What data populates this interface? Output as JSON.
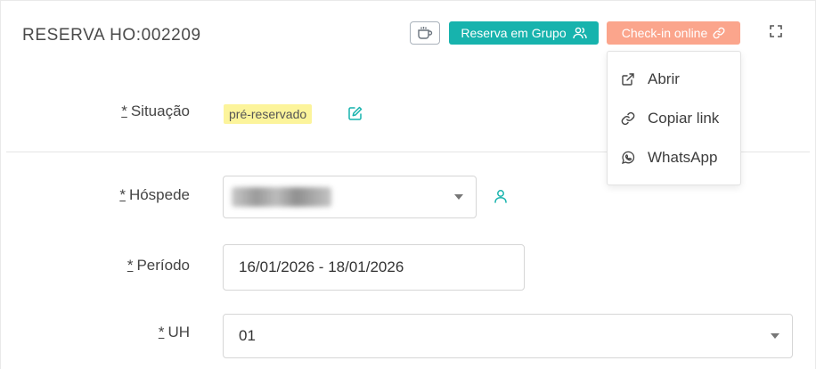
{
  "header": {
    "title": "RESERVA HO:002209",
    "coffee_icon": "coffee-cup-icon",
    "group_button_label": "Reserva em Grupo",
    "group_icon": "users-icon",
    "checkin_button_label": "Check-in online",
    "checkin_icon": "link-icon",
    "fullscreen_icon": "fullscreen-icon"
  },
  "checkin_menu": {
    "items": [
      {
        "label": "Abrir",
        "icon": "external-link-icon"
      },
      {
        "label": "Copiar link",
        "icon": "link-icon"
      },
      {
        "label": "WhatsApp",
        "icon": "whatsapp-icon"
      }
    ]
  },
  "form": {
    "required_mark": "*",
    "situacao": {
      "label": "Situação",
      "value": "pré-reservado",
      "badge_color": "#fcf49b"
    },
    "hospede": {
      "label": "Hóspede",
      "value": ""
    },
    "periodo": {
      "label": "Período",
      "value": "16/01/2026 - 18/01/2026"
    },
    "uh": {
      "label": "UH",
      "value": "01"
    }
  },
  "colors": {
    "teal": "#17b3ad",
    "salmon": "#fba58c",
    "badge": "#fcf49b"
  }
}
